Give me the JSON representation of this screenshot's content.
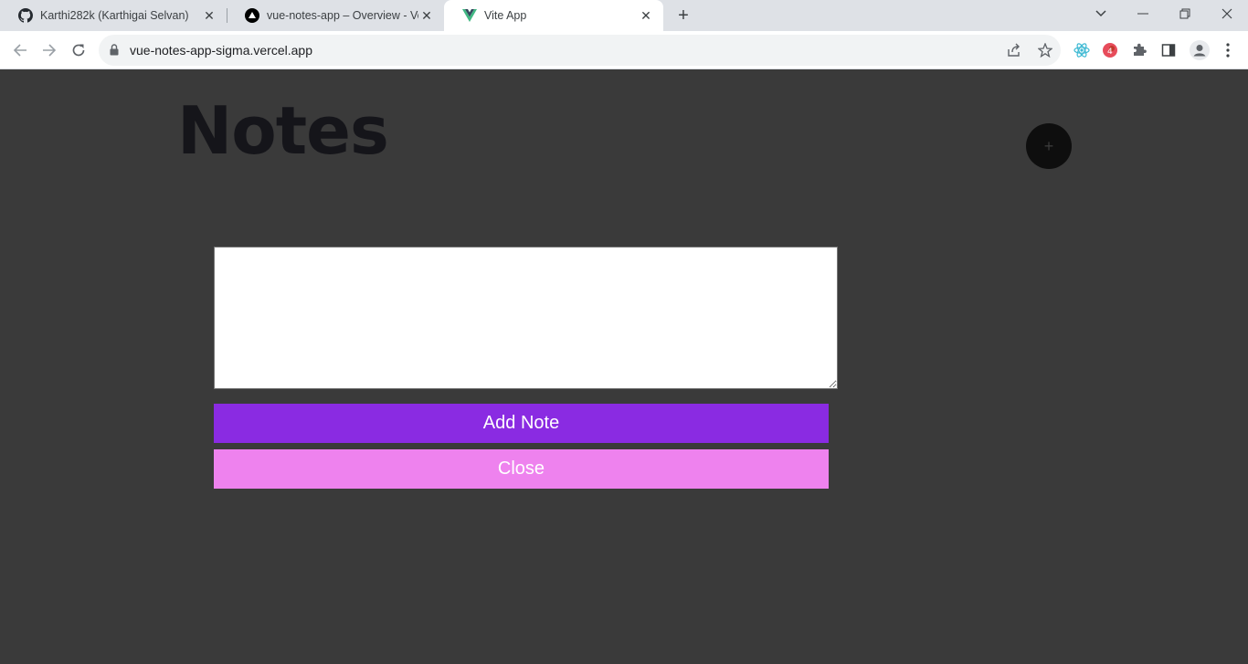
{
  "browser": {
    "tabs": [
      {
        "title": "Karthi282k (Karthigai Selvan)",
        "icon": "github-icon"
      },
      {
        "title": "vue-notes-app – Overview - Vercel",
        "icon": "vercel-icon"
      },
      {
        "title": "Vite App",
        "icon": "vue-icon",
        "active": true
      }
    ],
    "new_tab_label": "+",
    "address": "vue-notes-app-sigma.vercel.app",
    "close_glyph": "✕"
  },
  "page": {
    "heading": "Notes",
    "fab_label": "+",
    "textarea_value": "",
    "add_button": "Add Note",
    "close_button": "Close"
  },
  "colors": {
    "background": "#3a3a3a",
    "heading": "#15151a",
    "add_button": "#8a2be2",
    "close_button": "#ee82ee",
    "fab": "#0e0e0e"
  }
}
